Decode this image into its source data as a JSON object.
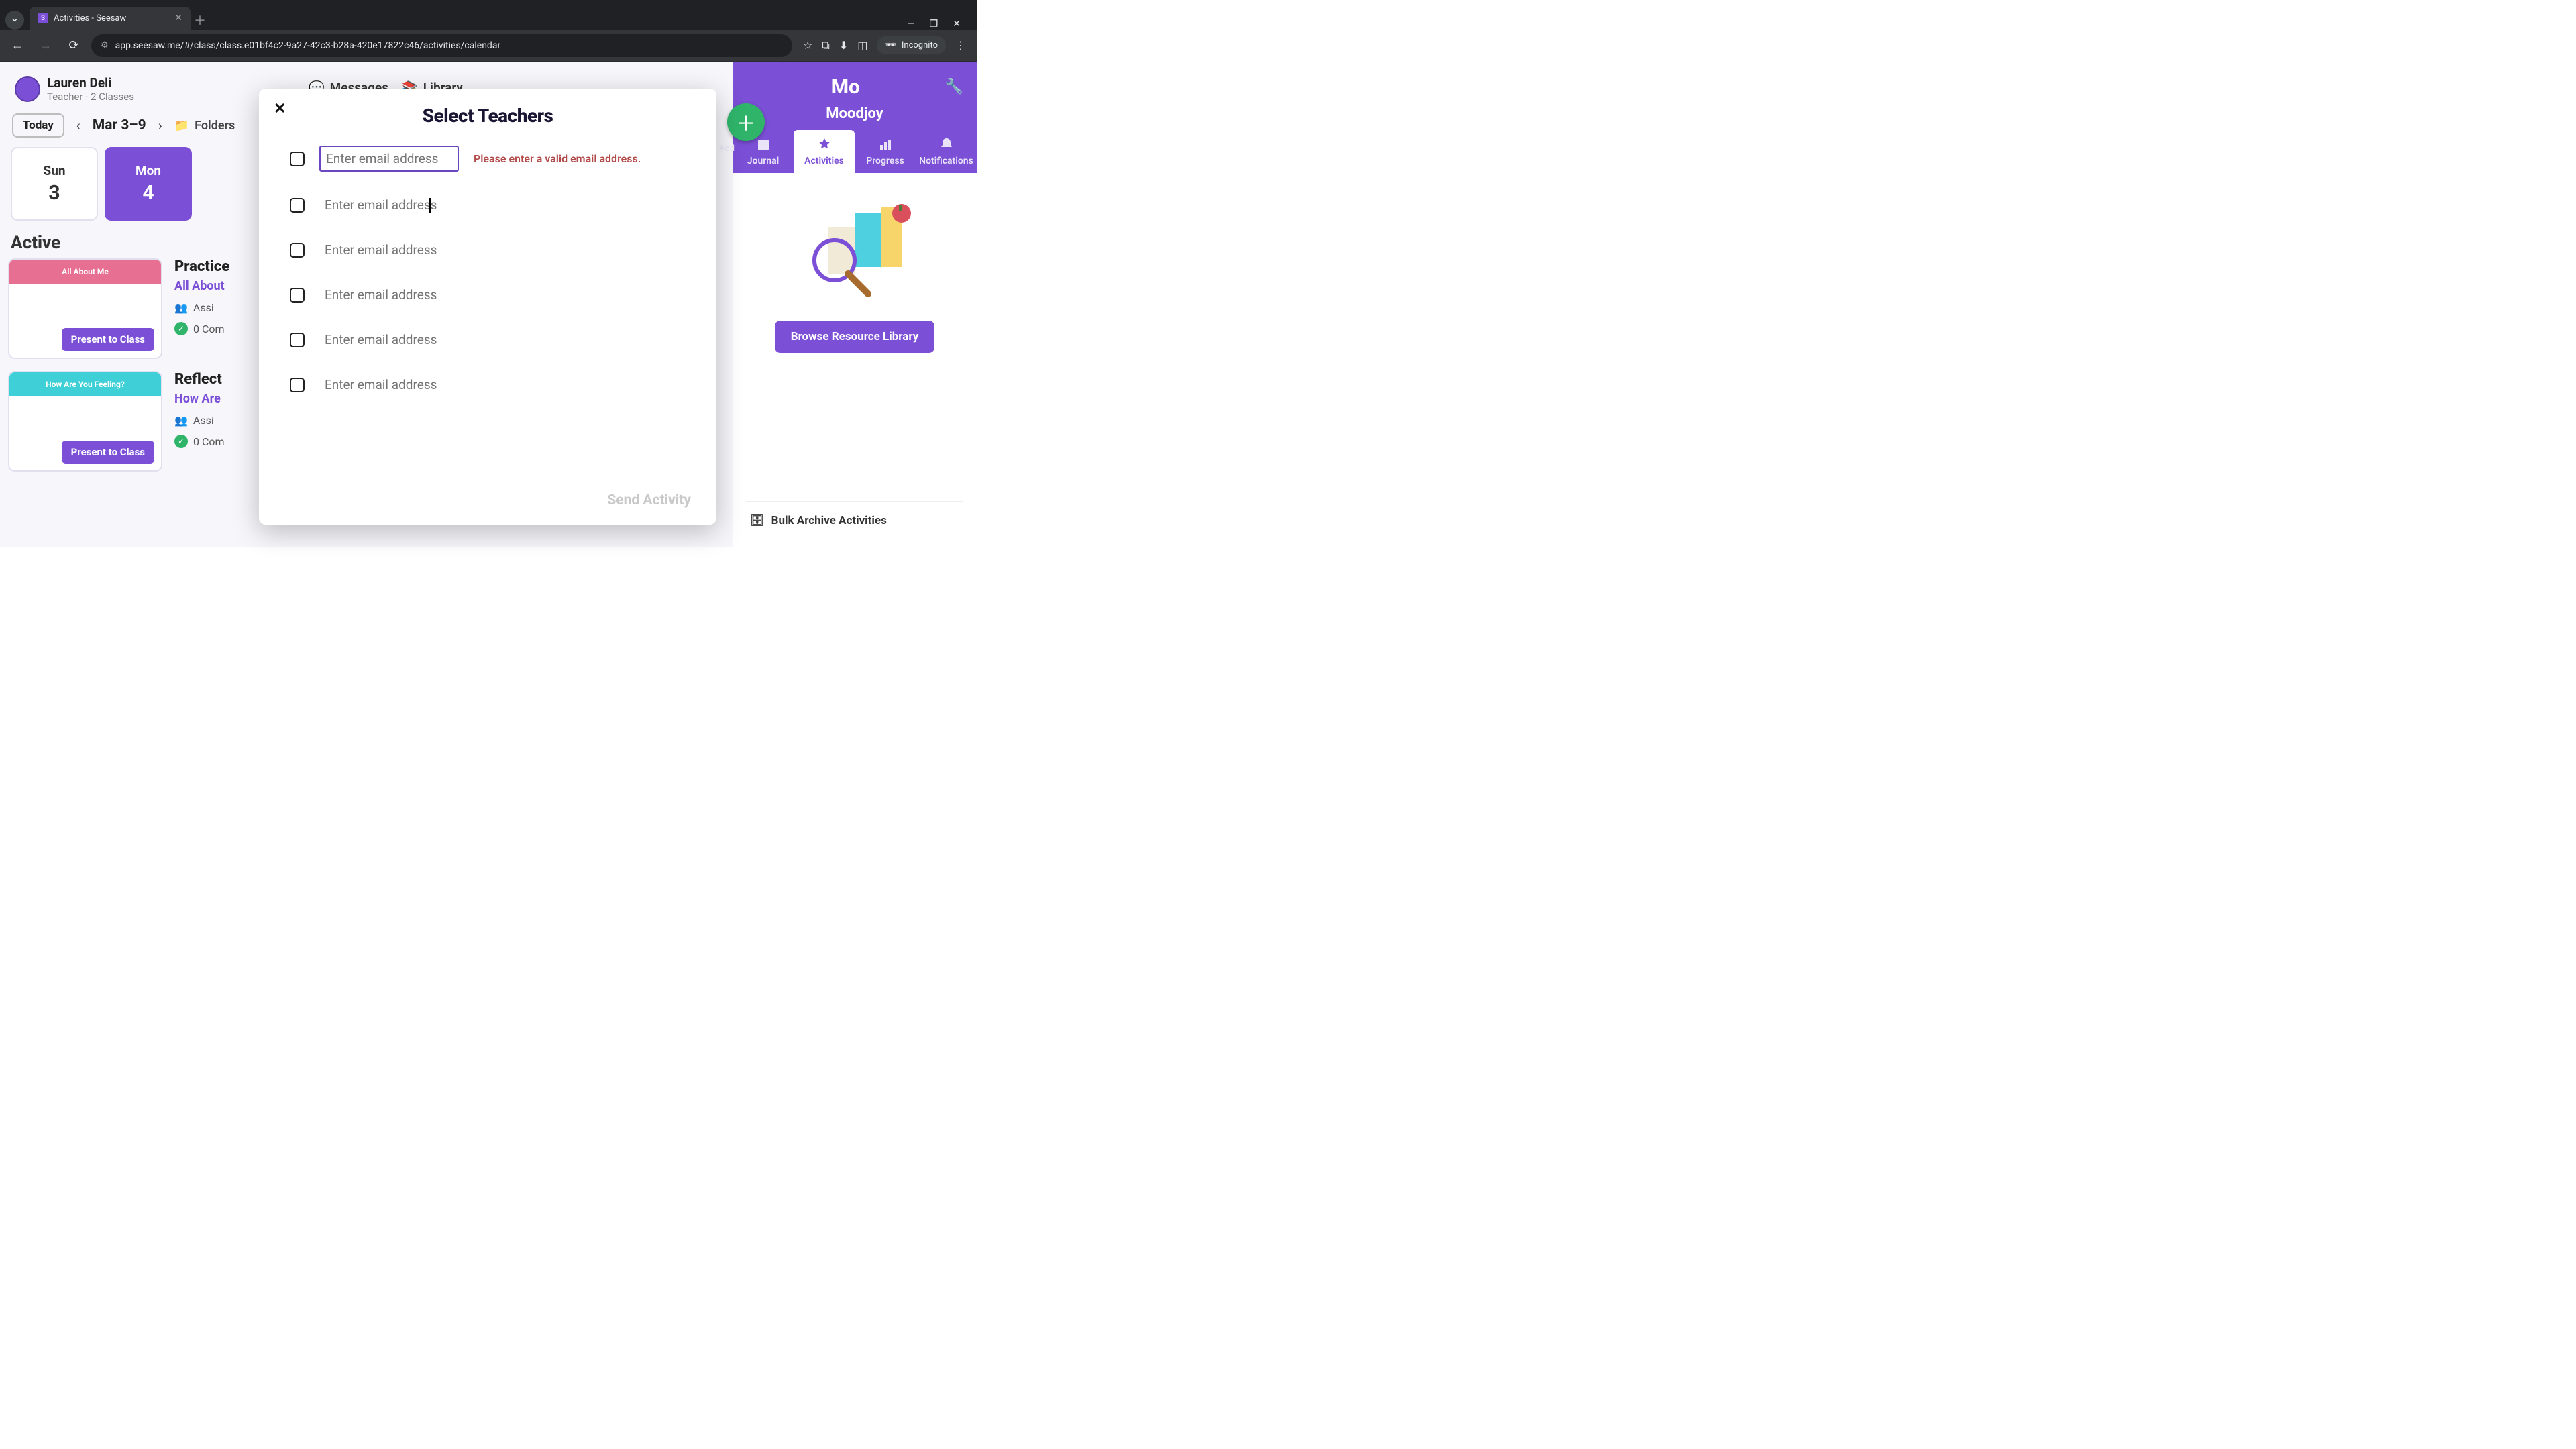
{
  "browser": {
    "tab_title": "Activities - Seesaw",
    "url": "app.seesaw.me/#/class/class.e01bf4c2-9a27-42c3-b28a-420e17822c46/activities/calendar",
    "incognito_label": "Incognito"
  },
  "user": {
    "name": "Lauren Deli",
    "role": "Teacher - 2 Classes"
  },
  "topnav": {
    "messages": "Messages",
    "library": "Library"
  },
  "calendar": {
    "today": "Today",
    "range": "Mar 3–9",
    "folders": "Folders",
    "days": [
      {
        "wd": "Sun",
        "dn": "3",
        "sel": false
      },
      {
        "wd": "Mon",
        "dn": "4",
        "sel": true
      }
    ]
  },
  "section_active": "Active",
  "present_label": "Present to Class",
  "cards": [
    {
      "thumb_title": "All About Me",
      "title": "Practice",
      "sub": "All About",
      "assigned": "Assi",
      "completed": "0 Com"
    },
    {
      "thumb_title": "How Are You Feeling?",
      "title": "Reflect",
      "sub": "How Are",
      "assigned": "Assi",
      "completed": "0 Com"
    }
  ],
  "right": {
    "add": "Add",
    "brand_short": "Mo",
    "class_name": "Moodjoy",
    "tabs": {
      "journal": "Journal",
      "activities": "Activities",
      "progress": "Progress",
      "notifications": "Notifications"
    },
    "browse": "Browse Resource Library",
    "bulk": "Bulk Archive Activities"
  },
  "modal": {
    "title": "Select Teachers",
    "placeholder": "Enter email address",
    "error": "Please enter a valid email address.",
    "send": "Send Activity"
  }
}
